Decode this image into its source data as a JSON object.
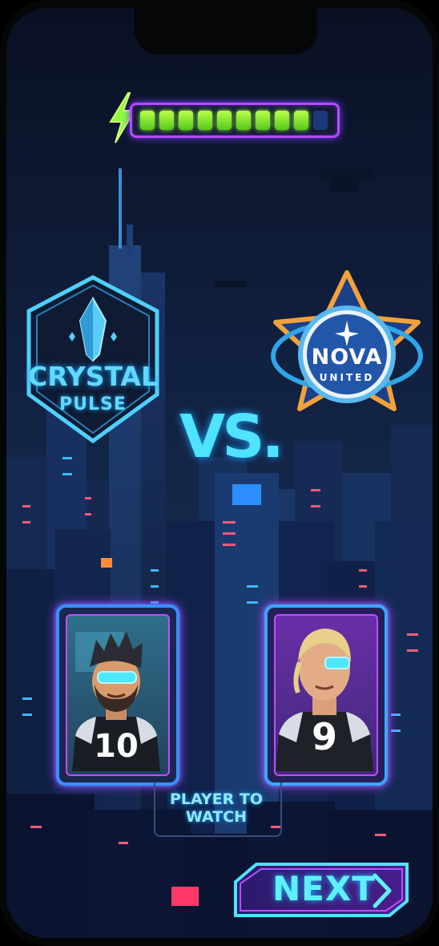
{
  "battery": {
    "level": 0.9,
    "segments_total": 10,
    "segments_filled": 9,
    "bolt_icon": "lightning-bolt-icon",
    "fill_color": "#8cff3a",
    "frame_color": "#b44bff"
  },
  "teams": {
    "home": {
      "name_line1": "CRYSTAL",
      "name_line2": "PULSE",
      "logo_icon": "crystal-shield-icon",
      "color": "#63d8ff"
    },
    "away": {
      "name_line1": "NOVA",
      "name_line2": "UNITED",
      "logo_icon": "star-badge-icon",
      "color": "#f2a23a"
    }
  },
  "versus_label": "VS.",
  "players": {
    "left": {
      "jersey_number": "10",
      "avatar": "player-avatar"
    },
    "right": {
      "jersey_number": "9",
      "avatar": "player-avatar"
    }
  },
  "player_to_watch": {
    "line1": "PLAYER TO",
    "line2": "WATCH"
  },
  "next_button": {
    "label": "NEXT",
    "icon": "chevron-right-icon",
    "accent": "#5ff0ff"
  }
}
